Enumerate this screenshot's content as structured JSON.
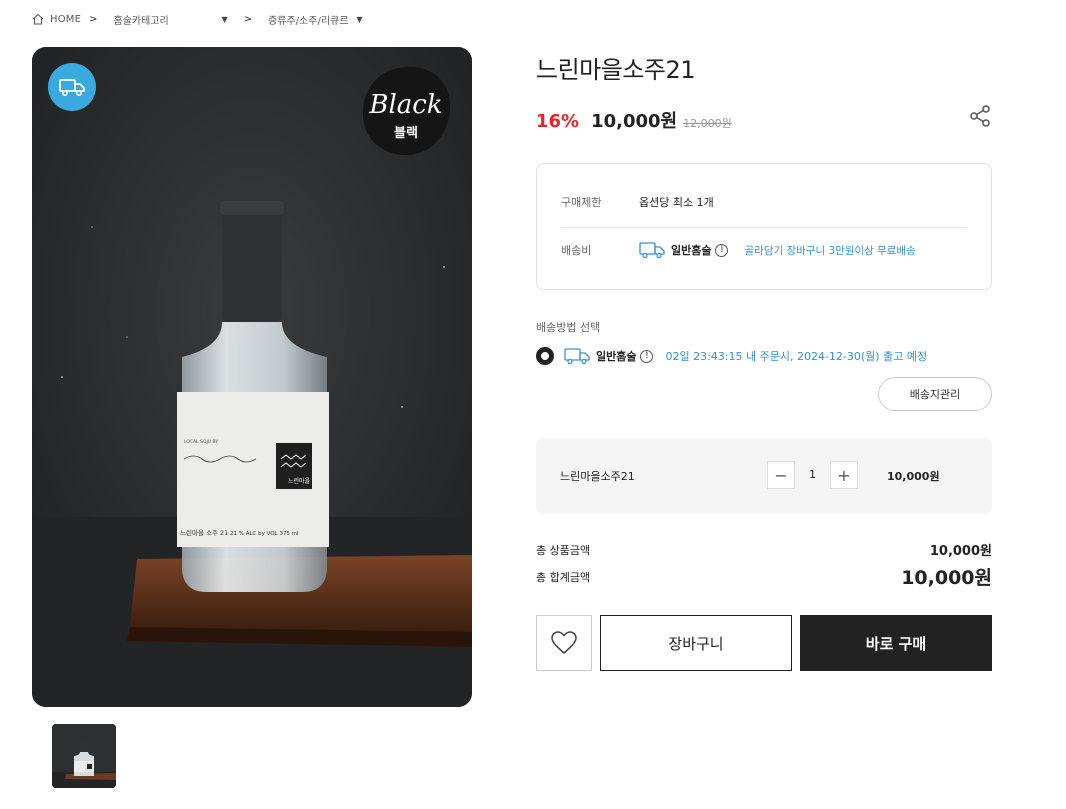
{
  "breadcrumb": {
    "home": "HOME",
    "separator": ">",
    "category1": "홈술카테고리",
    "category2": "증류주/소주/리큐르"
  },
  "product": {
    "image_badge_icon": "truck-icon",
    "badge_text_en": "Black",
    "badge_text_ko": "블랙",
    "label_text": "LOCAL SOJU BY",
    "label_brand": "느린마을 소주 21",
    "label_abv": "21 % ALC by VOL 375 ml",
    "label_logo": "느린마을",
    "title": "느린마을소주21",
    "discount": "16%",
    "price": "10,000원",
    "original_price": "12,000원"
  },
  "info": {
    "purchase_limit_label": "구매제한",
    "purchase_limit_value": "옵션당 최소 1개",
    "shipping_fee_label": "배송비",
    "shipping_type": "일반홈술",
    "shipping_info_icon": "!",
    "shipping_note": "골라담기 장바구니 3만원이상 무료배송"
  },
  "shipping_method": {
    "label": "배송방법 선택",
    "option_name": "일반홈술",
    "option_info_icon": "!",
    "eta": "02일 23:43:15 내 주문시, 2024-12-30(월) 출고 예정",
    "address_button": "배송지관리"
  },
  "cart_item": {
    "name": "느린마을소주21",
    "minus": "−",
    "quantity": "1",
    "plus": "+",
    "price": "10,000원"
  },
  "totals": {
    "product_total_label": "총 상품금액",
    "product_total_value": "10,000원",
    "grand_total_label": "총 합계금액",
    "grand_total_value": "10,000원"
  },
  "actions": {
    "cart": "장바구니",
    "buy_now": "바로 구매"
  },
  "colors": {
    "discount": "#e4252b",
    "accent_blue": "#3aa9e0",
    "link_blue": "#3a8fd0",
    "dark": "#222222"
  }
}
